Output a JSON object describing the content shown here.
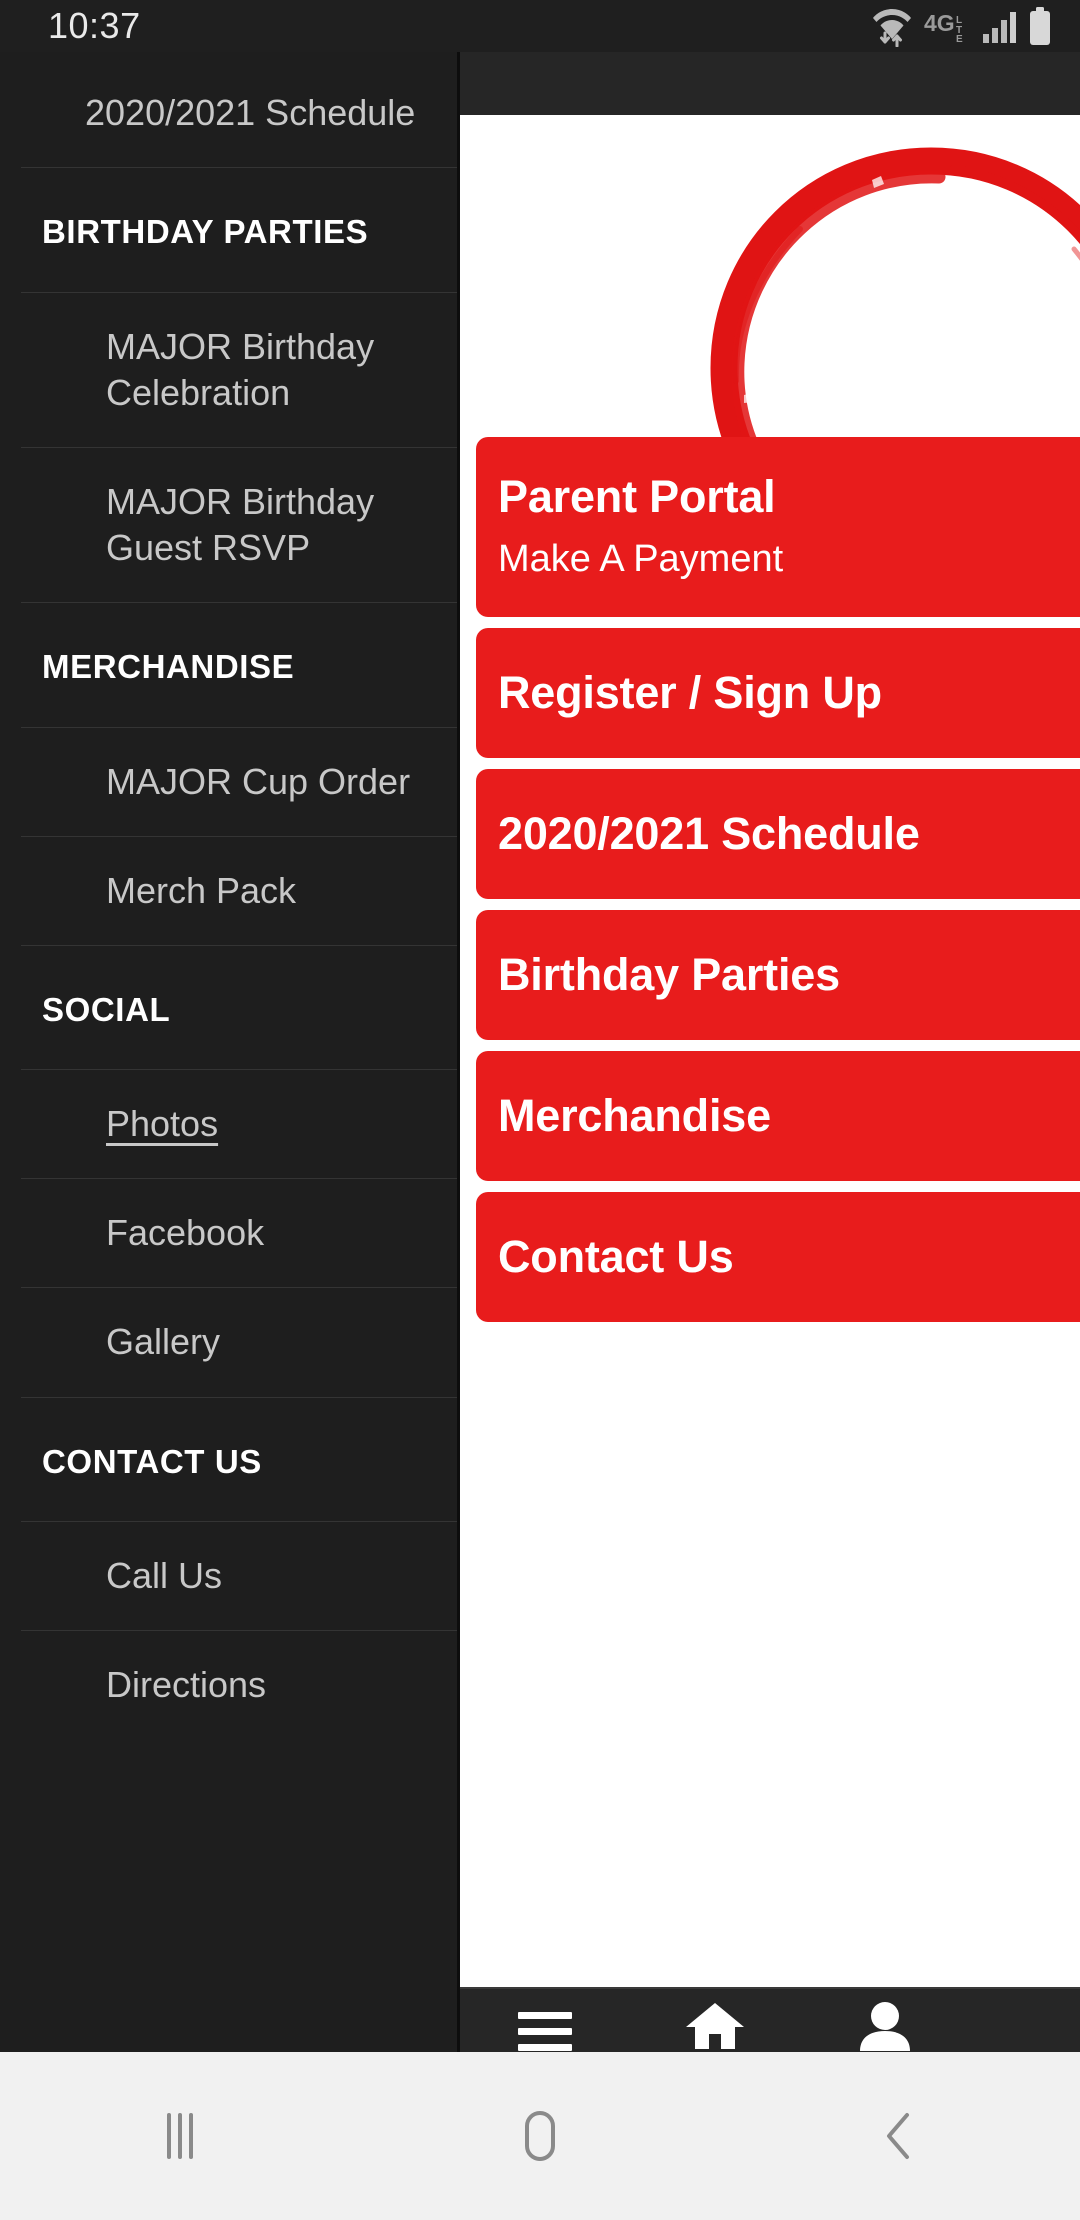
{
  "status_bar": {
    "time": "10:37",
    "icons": [
      "wifi-data-icon",
      "4g-lte-icon",
      "cellular-signal-icon",
      "battery-icon"
    ]
  },
  "colors": {
    "brand_red": "#e81c1c",
    "drawer_bg": "#1e1e1e",
    "active_tab": "#2e9ee0",
    "page_bg": "#ffffff"
  },
  "drawer": {
    "rows": [
      {
        "type": "item",
        "label": "2020/2021 Schedule",
        "underline": false
      },
      {
        "type": "section",
        "label": "BIRTHDAY PARTIES"
      },
      {
        "type": "item",
        "label": "MAJOR Birthday Celebration",
        "underline": false
      },
      {
        "type": "item",
        "label": "MAJOR Birthday Guest RSVP",
        "underline": false
      },
      {
        "type": "section",
        "label": "MERCHANDISE"
      },
      {
        "type": "item",
        "label": "MAJOR Cup Order",
        "underline": false
      },
      {
        "type": "item",
        "label": "Merch Pack",
        "underline": false
      },
      {
        "type": "section",
        "label": "SOCIAL"
      },
      {
        "type": "item",
        "label": "Photos",
        "underline": true
      },
      {
        "type": "item",
        "label": "Facebook",
        "underline": false
      },
      {
        "type": "item",
        "label": "Gallery",
        "underline": false
      },
      {
        "type": "section",
        "label": "CONTACT US"
      },
      {
        "type": "item",
        "label": "Call Us",
        "underline": false
      },
      {
        "type": "item",
        "label": "Directions",
        "underline": false
      }
    ]
  },
  "page": {
    "logo": "red-brush-circle-logo",
    "cta_buttons": [
      {
        "title": "Parent Portal",
        "subtitle": "Make A Payment",
        "tall": true
      },
      {
        "title": "Register / Sign Up",
        "subtitle": "",
        "tall": false
      },
      {
        "title": "2020/2021 Schedule",
        "subtitle": "",
        "tall": false
      },
      {
        "title": "Birthday Parties",
        "subtitle": "",
        "tall": false
      },
      {
        "title": "Merchandise",
        "subtitle": "",
        "tall": false
      },
      {
        "title": "Contact Us",
        "subtitle": "",
        "tall": false
      }
    ]
  },
  "tab_bar": {
    "tabs": [
      {
        "label": "Menu",
        "icon": "hamburger-menu-icon",
        "active": false
      },
      {
        "label": "Home",
        "icon": "home-icon",
        "active": true
      },
      {
        "label": "Parent Portal",
        "icon": "person-icon",
        "active": false
      }
    ]
  },
  "android_nav": {
    "buttons": [
      {
        "name": "recents",
        "icon": "recents-icon"
      },
      {
        "name": "home",
        "icon": "home-square-icon"
      },
      {
        "name": "back",
        "icon": "back-chevron-icon"
      }
    ]
  }
}
